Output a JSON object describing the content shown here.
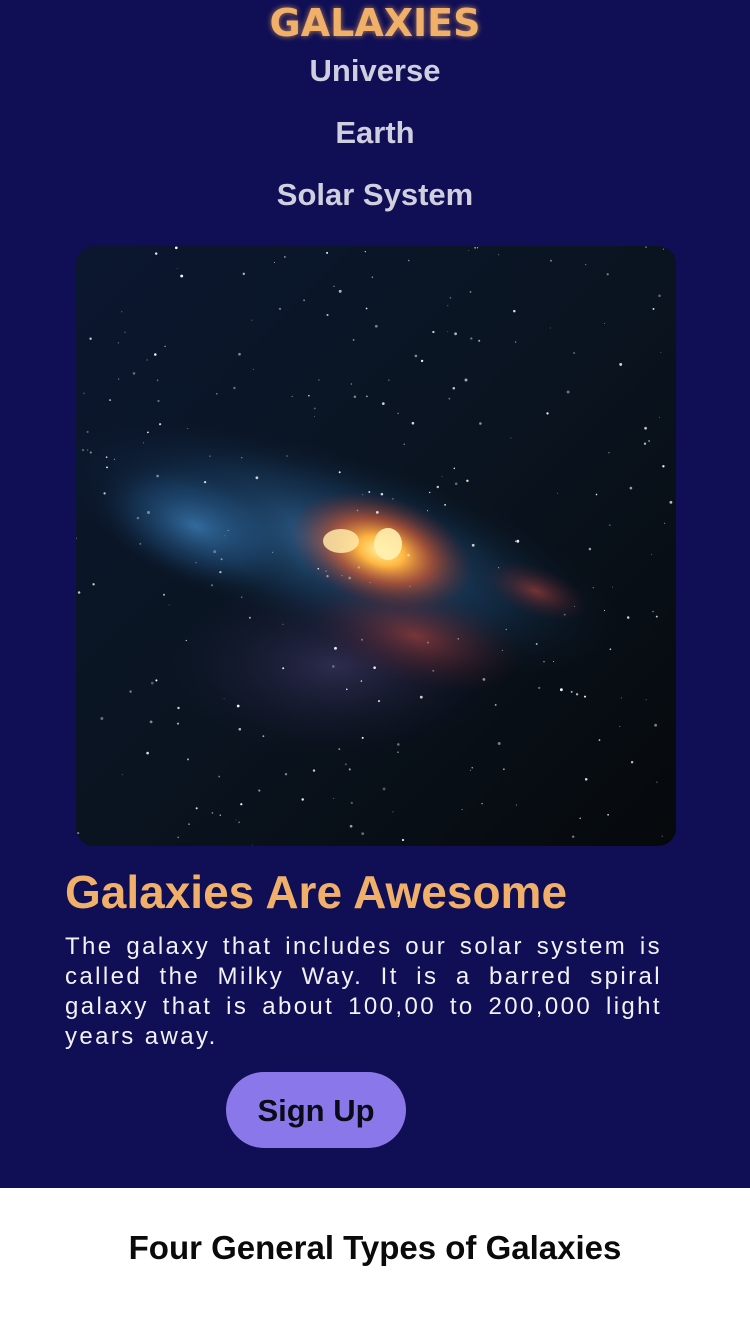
{
  "header": {
    "logo": "GALAXIES"
  },
  "nav": {
    "items": [
      {
        "label": "Universe"
      },
      {
        "label": "Earth"
      },
      {
        "label": "Solar System"
      }
    ]
  },
  "hero": {
    "image_subject": "milky-way-galaxy-photo",
    "headline": "Galaxies Are Awesome",
    "body": "The galaxy that includes our solar system is called the Milky Way. It is a barred spiral galaxy that is about 100,00 to 200,000 light years away.",
    "cta_label": "Sign Up"
  },
  "types_section": {
    "heading": "Four General Types of Galaxies"
  },
  "colors": {
    "hero_background": "#100f55",
    "accent": "#f0b06a",
    "nav_text": "#cfcfe0",
    "button": "#8a78ea",
    "page_background": "#ffffff"
  }
}
